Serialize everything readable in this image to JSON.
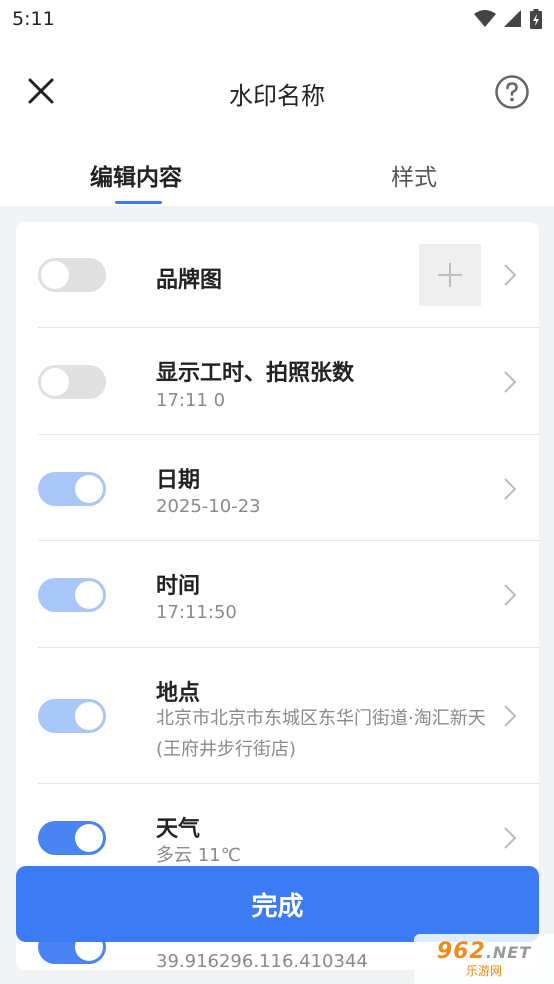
{
  "status_bar": {
    "time": "5:11"
  },
  "header": {
    "title": "水印名称"
  },
  "tabs": [
    {
      "label": "编辑内容",
      "active": true
    },
    {
      "label": "样式",
      "active": false
    }
  ],
  "rows": [
    {
      "title": "品牌图",
      "subtitle": "",
      "toggle": "off"
    },
    {
      "title": "显示工时、拍照张数",
      "subtitle": "17:11  0",
      "toggle": "off"
    },
    {
      "title": "日期",
      "subtitle": "2025-10-23",
      "toggle": "on"
    },
    {
      "title": "时间",
      "subtitle": "17:11:50",
      "toggle": "on"
    },
    {
      "title": "地点",
      "subtitle": "北京市北京市东城区东华门街道·淘汇新天(王府井步行街店)",
      "toggle": "on"
    },
    {
      "title": "天气",
      "subtitle": "多云 11℃",
      "toggle": "on"
    },
    {
      "title": "",
      "subtitle": "39.916296.116.410344",
      "toggle": "on"
    }
  ],
  "done_button": {
    "label": "完成"
  },
  "watermark": {
    "logo": "962",
    "logo_suffix": ".NET",
    "site": "乐游网"
  },
  "colors": {
    "accent": "#3b7cf5",
    "toggle_on_light": "#a9c6f8",
    "toggle_on": "#4a84f3",
    "toggle_off": "#e0e0e0"
  }
}
